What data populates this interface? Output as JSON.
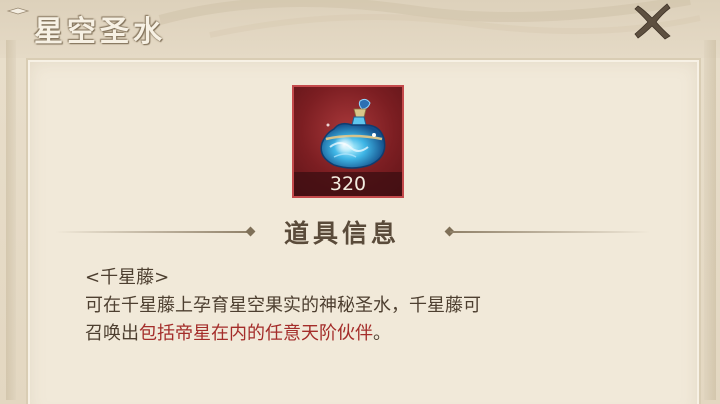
{
  "dialog": {
    "title": "星空圣水",
    "close_icon": "close-x-icon"
  },
  "item": {
    "icon": "star-holy-water-bottle-icon",
    "count": "320",
    "frame_color": "#a8383a"
  },
  "info_section": {
    "title": "道具信息"
  },
  "description": {
    "name_tag": "<千星藤>",
    "line1": "可在千星藤上孕育星空果实的神秘圣水，千星藤可",
    "line2_prefix": "召唤出",
    "line2_highlight": "包括帝星在内的任意天阶伙伴",
    "line2_suffix": "。",
    "highlight_color": "#a42d2a"
  }
}
